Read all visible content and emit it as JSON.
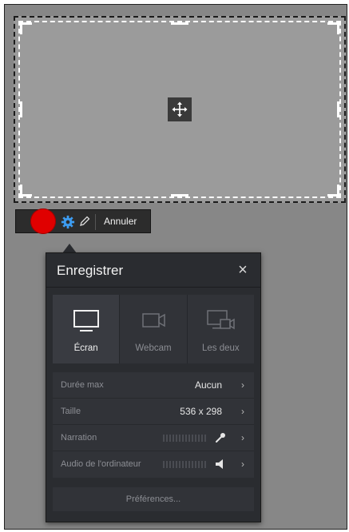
{
  "toolbar": {
    "record_button": "record",
    "settings_icon": "gear-icon",
    "edit_icon": "pencil-icon",
    "cancel_label": "Annuler",
    "accent_color": "#e00000"
  },
  "capture_area": {
    "move_icon": "move-arrows-icon"
  },
  "panel": {
    "title": "Enregistrer",
    "close_symbol": "×",
    "sources": [
      {
        "label": "Écran",
        "icon": "monitor-icon",
        "active": true
      },
      {
        "label": "Webcam",
        "icon": "webcam-icon",
        "active": false
      },
      {
        "label": "Les deux",
        "icon": "screen-and-webcam-icon",
        "active": false
      }
    ],
    "options": [
      {
        "label": "Durée max",
        "value": "Aucun"
      },
      {
        "label": "Taille",
        "value": "536 x 298"
      },
      {
        "label": "Narration",
        "icon": "microphone-icon"
      },
      {
        "label": "Audio de l'ordinateur",
        "icon": "speaker-icon"
      }
    ],
    "chevron": "›",
    "preferences_label": "Préférences..."
  }
}
